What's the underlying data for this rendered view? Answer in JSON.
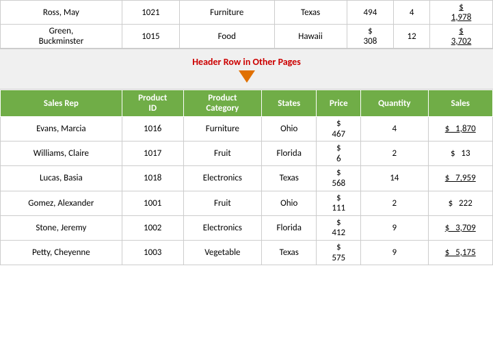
{
  "topRows": [
    {
      "salesRep": "Ross, May",
      "productID": "1021",
      "productCategory": "Furniture",
      "states": "Texas",
      "price": "494",
      "quantity": "4",
      "sales": "1,978",
      "salesPrefix": "$",
      "pricePrefix": ""
    },
    {
      "salesRep": "Green,\nBuckminster",
      "productID": "1015",
      "productCategory": "Food",
      "states": "Hawaii",
      "price": "308",
      "quantity": "12",
      "sales": "3,702",
      "salesPrefix": "$",
      "pricePrefix": "$"
    }
  ],
  "headerLabel": "Header Row in Other Pages",
  "headers": {
    "salesRep": "Sales Rep",
    "productID": "Product\nID",
    "productCategory": "Product\nCategory",
    "states": "States",
    "price": "Price",
    "quantity": "Quantity",
    "sales": "Sales"
  },
  "mainRows": [
    {
      "salesRep": "Evans, Marcia",
      "productID": "1016",
      "productCategory": "Furniture",
      "states": "Ohio",
      "priceTop": "$",
      "priceBottom": "467",
      "quantity": "4",
      "salesTop": "$",
      "salesBottom": "1,870",
      "salesUnderline": true
    },
    {
      "salesRep": "Williams, Claire",
      "productID": "1017",
      "productCategory": "Fruit",
      "states": "Florida",
      "priceTop": "$",
      "priceBottom": "6",
      "quantity": "2",
      "salesTop": "$",
      "salesBottom": "13",
      "salesUnderline": false
    },
    {
      "salesRep": "Lucas, Basia",
      "productID": "1018",
      "productCategory": "Electronics",
      "states": "Texas",
      "priceTop": "$",
      "priceBottom": "568",
      "quantity": "14",
      "salesTop": "$",
      "salesBottom": "7,959",
      "salesUnderline": true
    },
    {
      "salesRep": "Gomez, Alexander",
      "productID": "1001",
      "productCategory": "Fruit",
      "states": "Ohio",
      "priceTop": "$",
      "priceBottom": "111",
      "quantity": "2",
      "salesTop": "$",
      "salesBottom": "222",
      "salesUnderline": false
    },
    {
      "salesRep": "Stone, Jeremy",
      "productID": "1002",
      "productCategory": "Electronics",
      "states": "Florida",
      "priceTop": "$",
      "priceBottom": "412",
      "quantity": "9",
      "salesTop": "$",
      "salesBottom": "3,709",
      "salesUnderline": true
    },
    {
      "salesRep": "Petty, Cheyenne",
      "productID": "1003",
      "productCategory": "Vegetable",
      "states": "Texas",
      "priceTop": "$",
      "priceBottom": "575",
      "quantity": "9",
      "salesTop": "$",
      "salesBottom": "5,175",
      "salesUnderline": true
    }
  ]
}
